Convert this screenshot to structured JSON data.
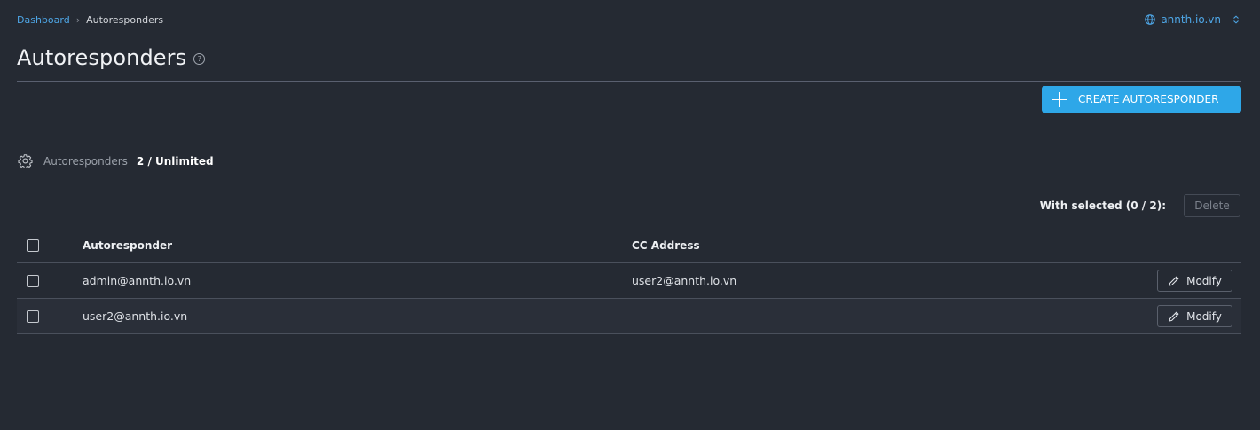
{
  "breadcrumb": {
    "root": "Dashboard",
    "separator": "›",
    "current": "Autoresponders"
  },
  "domain_selector": {
    "value": "annth.io.vn"
  },
  "page": {
    "title": "Autoresponders",
    "help_icon": "?"
  },
  "actions": {
    "create_label": "CREATE AUTORESPONDER"
  },
  "stats": {
    "label": "Autoresponders",
    "value": "2 / Unlimited"
  },
  "bulk": {
    "selected_text": "With selected (0 / 2):",
    "delete_label": "Delete"
  },
  "table": {
    "columns": [
      "Autoresponder",
      "CC Address"
    ],
    "rows": [
      {
        "autoresponder": "admin@annth.io.vn",
        "cc": "user2@annth.io.vn",
        "action": "Modify"
      },
      {
        "autoresponder": "user2@annth.io.vn",
        "cc": "",
        "action": "Modify"
      }
    ]
  },
  "colors": {
    "background": "#252a33",
    "accent": "#2ea7e8",
    "link": "#4ea6e6"
  }
}
